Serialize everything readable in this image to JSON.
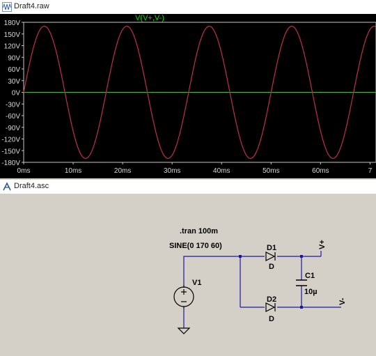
{
  "waveform": {
    "title": "Draft4.raw",
    "trace_label": "V(V+,V-)",
    "trace_color": "#c0304a",
    "zero_line_color": "#3fbf3f",
    "label_color": "#00e000",
    "background": "#000000"
  },
  "chart_data": {
    "type": "line",
    "title": "V(V+,V-)",
    "xlabel": "",
    "ylabel": "",
    "xlim": [
      0,
      70
    ],
    "ylim": [
      -180,
      180
    ],
    "x_unit": "ms",
    "y_unit": "V",
    "y_ticks": [
      "180V",
      "150V",
      "120V",
      "90V",
      "60V",
      "30V",
      "0V",
      "-30V",
      "-60V",
      "-90V",
      "-120V",
      "-150V",
      "-180V"
    ],
    "x_ticks": [
      "0ms",
      "10ms",
      "20ms",
      "30ms",
      "40ms",
      "50ms",
      "60ms",
      "7"
    ],
    "series": [
      {
        "name": "V(V+,V-)",
        "amplitude": 170,
        "frequency_hz": 60,
        "color": "#c0304a"
      }
    ],
    "grid": false
  },
  "schematic": {
    "title": "Draft4.asc",
    "directive": ".tran 100m",
    "source_value": "SINE(0 170 60)",
    "source_name": "V1",
    "d1_name": "D1",
    "d1_model": "D",
    "d2_name": "D2",
    "d2_model": "D",
    "cap_name": "C1",
    "cap_value": "10µ",
    "net_pos": "V+",
    "net_neg": "V-",
    "wire_color": "#1a1aa0"
  }
}
